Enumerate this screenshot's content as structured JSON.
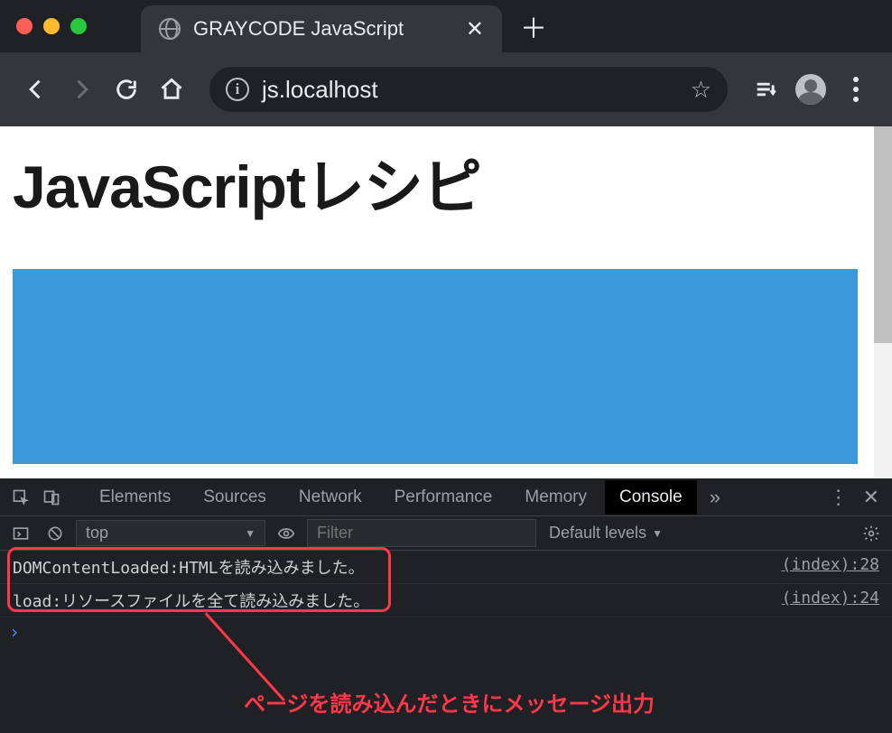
{
  "titlebar": {
    "tab_title": "GRAYCODE JavaScript"
  },
  "toolbar": {
    "url": "js.localhost"
  },
  "page": {
    "heading": "JavaScriptレシピ"
  },
  "devtools": {
    "tabs": {
      "elements": "Elements",
      "sources": "Sources",
      "network": "Network",
      "performance": "Performance",
      "memory": "Memory",
      "console": "Console",
      "more": "»"
    },
    "console_bar": {
      "context": "top",
      "filter_placeholder": "Filter",
      "levels": "Default levels"
    },
    "logs": [
      {
        "msg": "DOMContentLoaded:HTMLを読み込みました。",
        "src": "(index):28"
      },
      {
        "msg": "load:リソースファイルを全て読み込みました。",
        "src": "(index):24"
      }
    ],
    "prompt": "›"
  },
  "annotation": "ページを読み込んだときにメッセージ出力"
}
